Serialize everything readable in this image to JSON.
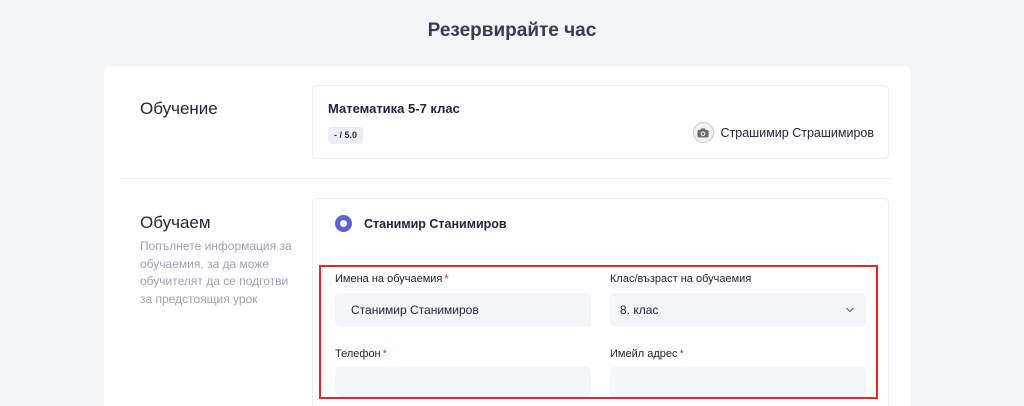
{
  "page": {
    "title": "Резервирайте час"
  },
  "training": {
    "title": "Обучение",
    "course_name": "Математика 5-7 клас",
    "rating": "- / 5.0",
    "tutor_name": "Страшимир Страшимиров"
  },
  "student": {
    "title": "Обучаем",
    "description_lines": [
      "Попълнете информация за",
      "обучаемия, за да може",
      "обучителят да се подготви",
      "за предстоящия урок"
    ],
    "selected_student": "Станимир Станимиров",
    "form": {
      "name_label": "Имена на обучаемия",
      "name_value": "Станимир Станимиров",
      "grade_label": "Клас/възраст на обучаемия",
      "grade_value": "8. клас",
      "phone_label": "Телефон",
      "phone_value": "",
      "email_label": "Имейл адрес",
      "email_value": "",
      "required_mark": "*"
    }
  },
  "colors": {
    "accent": "#5a62d6",
    "required": "#e8242a",
    "highlight_border": "#e8242a",
    "input_bg": "#f3f5f8"
  },
  "icons": {
    "tutor_avatar": "camera-icon",
    "select_arrow": "chevron-down-icon"
  }
}
